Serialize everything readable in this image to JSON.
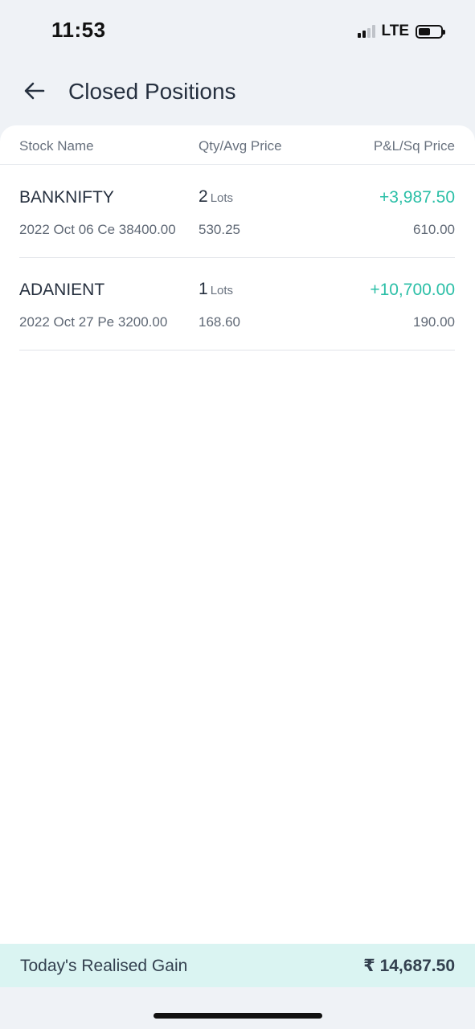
{
  "status_bar": {
    "time": "11:53",
    "network": "LTE",
    "battery_level": 0.55
  },
  "header": {
    "title": "Closed Positions",
    "back_icon": "arrow-left-icon"
  },
  "table": {
    "columns": [
      "Stock Name",
      "Qty/Avg Price",
      "P&L/Sq Price"
    ],
    "rows": [
      {
        "stock": "BANKNIFTY",
        "contract": "2022 Oct 06 Ce 38400.00",
        "qty": "2",
        "lots_label": "Lots",
        "avg_price": "530.25",
        "pnl": "+3,987.50",
        "sq_price": "610.00"
      },
      {
        "stock": "ADANIENT",
        "contract": "2022 Oct 27 Pe 3200.00",
        "qty": "1",
        "lots_label": "Lots",
        "avg_price": "168.60",
        "pnl": "+10,700.00",
        "sq_price": "190.00"
      }
    ]
  },
  "footer": {
    "label": "Today's Realised Gain",
    "value": "₹ 14,687.50"
  },
  "colors": {
    "gain": "#2bbfa7",
    "footer_bg": "#daf4f2",
    "page_bg": "#eff2f6"
  }
}
